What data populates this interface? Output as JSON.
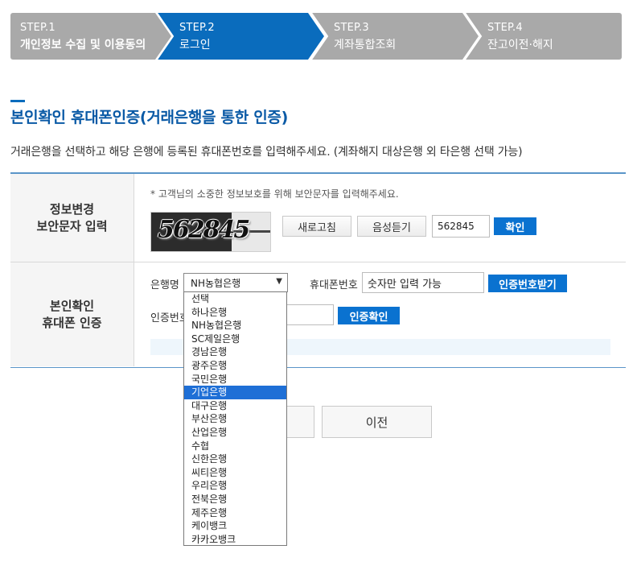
{
  "steps": [
    {
      "num": "STEP.1",
      "name": "개인정보 수집 및 이용동의",
      "active": false
    },
    {
      "num": "STEP.2",
      "name": "로그인",
      "active": true
    },
    {
      "num": "STEP.3",
      "name": "계좌통합조회",
      "active": false
    },
    {
      "num": "STEP.4",
      "name": "잔고이전·해지",
      "active": false
    }
  ],
  "heading": {
    "title": "본인확인 휴대폰인증(거래은행을 통한 인증)",
    "description": "거래은행을 선택하고 해당 은행에 등록된 휴대폰번호를 입력해주세요. (계좌해지 대상은행 외 타은행 선택 가능)"
  },
  "security": {
    "header": "정보변경\n보안문자 입력",
    "notice": "* 고객님의 소중한 정보보호를 위해 보안문자를 입력해주세요.",
    "captcha_text": "562845",
    "refresh_label": "새로고침",
    "audio_label": "음성듣기",
    "input_value": "562845",
    "confirm_label": "확인"
  },
  "phone_auth": {
    "header": "본인확인\n휴대폰 인증",
    "bank_label": "은행명",
    "bank_selected": "NH농협은행",
    "phone_label": "휴대폰번호",
    "phone_placeholder": "숫자만 입력 가능",
    "request_code_label": "인증번호받기",
    "code_label": "인증번호",
    "verify_label": "인증확인"
  },
  "buttons": {
    "prev_label": "이전"
  },
  "bank_options": [
    "선택",
    "하나은행",
    "NH농협은행",
    "SC제일은행",
    "경남은행",
    "광주은행",
    "국민은행",
    "기업은행",
    "대구은행",
    "부산은행",
    "산업은행",
    "수협",
    "신한은행",
    "씨티은행",
    "우리은행",
    "전북은행",
    "제주은행",
    "케이뱅크",
    "카카오뱅크"
  ],
  "bank_highlighted": "기업은행",
  "colors": {
    "accent": "#0a6cbd",
    "step_inactive": "#a9a9a9",
    "button_blue": "#0a72d0"
  }
}
